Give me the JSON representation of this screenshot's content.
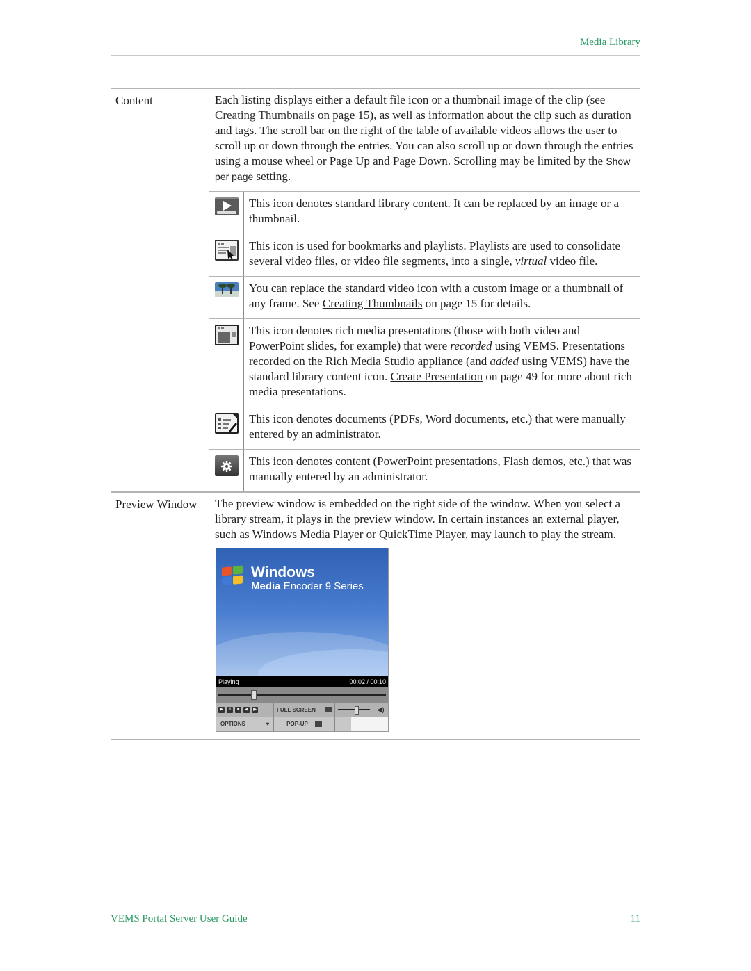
{
  "header": {
    "section_title": "Media Library"
  },
  "table": {
    "rows": [
      {
        "label": "Content",
        "intro": {
          "p1": "Each listing displays either a default file icon or a thumbnail image of the clip (see ",
          "link1": "Creating Thumbnails",
          "p2": " on page 15), as well as information about the clip such as duration and tags. The scroll bar on the right of the table of available videos allows the user to scroll up or down through the entries. You can also scroll up or down through the entries using a mouse wheel or Page Up and Page Down. Scrolling may be limited by the ",
          "setting_name": "Show per page",
          "p3": "  setting."
        },
        "icons": [
          {
            "icon": "standard-video-icon",
            "text": "This icon denotes standard library content. It can be replaced by an image or a thumbnail."
          },
          {
            "icon": "playlist-icon",
            "text_a": "This icon is used for bookmarks and playlists. Playlists are used to consolidate several video files, or video file segments, into a single, ",
            "text_em": "virtual",
            "text_b": " video file."
          },
          {
            "icon": "thumbnail-image-icon",
            "text_a": "You can replace the standard video icon with a custom image or a thumbnail of any frame. See ",
            "link": "Creating Thumbnails",
            "text_b": " on page 15 for details."
          },
          {
            "icon": "rich-media-presentation-icon",
            "text_a": "This icon denotes rich media presentations (those with both video and PowerPoint slides, for example) that were ",
            "em1": "recorded",
            "text_b": " using VEMS. Presentations recorded on the Rich Media Studio appliance (and ",
            "em2": "added",
            "text_c": " using VEMS) have the standard library content icon. ",
            "link": "Create Presentation",
            "text_d": " on page 49 for more about rich media presentations."
          },
          {
            "icon": "document-icon",
            "text": "This icon denotes documents (PDFs, Word documents, etc.) that were manually entered by an administrator."
          },
          {
            "icon": "content-gear-icon",
            "text": "This icon denotes content (PowerPoint presentations, Flash demos, etc.) that was manually entered by an administrator."
          }
        ]
      },
      {
        "label": "Preview Window",
        "text": "The preview window is embedded on the right side of the window. When you select a library stream, it plays in the preview window. In certain instances an external player, such as Windows Media Player or QuickTime Player, may launch to play the stream.",
        "player": {
          "brand_line1": "Windows",
          "brand_media": "Media",
          "brand_line2": " Encoder 9 Series",
          "status": "Playing",
          "time": "00:02 / 00:10",
          "seek_fraction": 0.2,
          "volume_fraction": 0.55,
          "buttons": [
            "play",
            "pause",
            "stop",
            "rewind",
            "fast-forward"
          ],
          "fullscreen_label": "FULL SCREEN",
          "options_label": "OPTIONS",
          "popup_label": "POP-UP"
        }
      }
    ]
  },
  "footer": {
    "guide_title": "VEMS Portal Server User Guide",
    "page_number": "11"
  },
  "colors": {
    "accent": "#2a9a63"
  }
}
